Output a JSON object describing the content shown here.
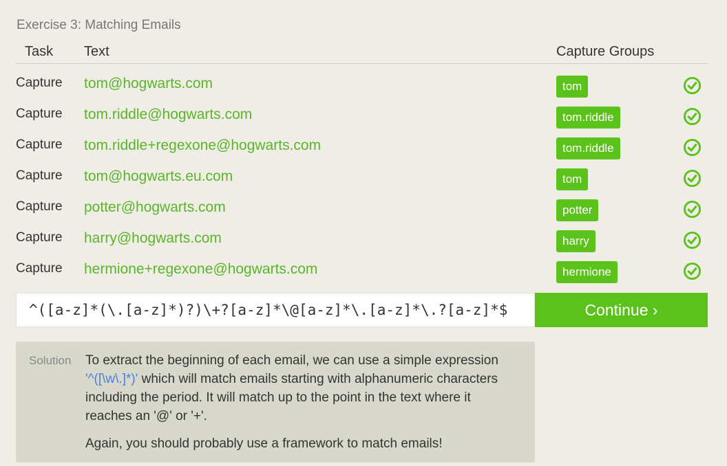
{
  "exercise": {
    "title": "Exercise 3: Matching Emails"
  },
  "table": {
    "headers": {
      "task": "Task",
      "text": "Text",
      "groups": "Capture Groups"
    },
    "rows": [
      {
        "task": "Capture",
        "text": "tom@hogwarts.com",
        "group": "tom",
        "status": "check-circle-icon"
      },
      {
        "task": "Capture",
        "text": "tom.riddle@hogwarts.com",
        "group": "tom.riddle",
        "status": "check-circle-icon"
      },
      {
        "task": "Capture",
        "text": "tom.riddle+regexone@hogwarts.com",
        "group": "tom.riddle",
        "status": "check-circle-icon"
      },
      {
        "task": "Capture",
        "text": "tom@hogwarts.eu.com",
        "group": "tom",
        "status": "check-circle-icon"
      },
      {
        "task": "Capture",
        "text": "potter@hogwarts.com",
        "group": "potter",
        "status": "check-circle-icon"
      },
      {
        "task": "Capture",
        "text": "harry@hogwarts.com",
        "group": "harry",
        "status": "check-circle-icon"
      },
      {
        "task": "Capture",
        "text": "hermione+regexone@hogwarts.com",
        "group": "hermione",
        "status": "check-circle-icon"
      }
    ]
  },
  "input": {
    "value": "^([a-z]*(\\.[a-z]*)?)\\+?[a-z]*\\@[a-z]*\\.[a-z]*\\.?[a-z]*$"
  },
  "continue": {
    "label": "Continue ›"
  },
  "solution": {
    "label": "Solution",
    "text_before": "To extract the beginning of each email, we can use a simple expression ",
    "code": "'^([\\w\\.]*)'",
    "text_after": " which will match emails starting with alphanumeric characters including the period. It will match up to the point in the text where it reaches an '@' or '+'.",
    "note": "Again, you should probably use a framework to match emails!"
  },
  "colors": {
    "accent": "#5bc21c",
    "text_green": "#5ab52a",
    "code_blue": "#4a7fd9"
  }
}
